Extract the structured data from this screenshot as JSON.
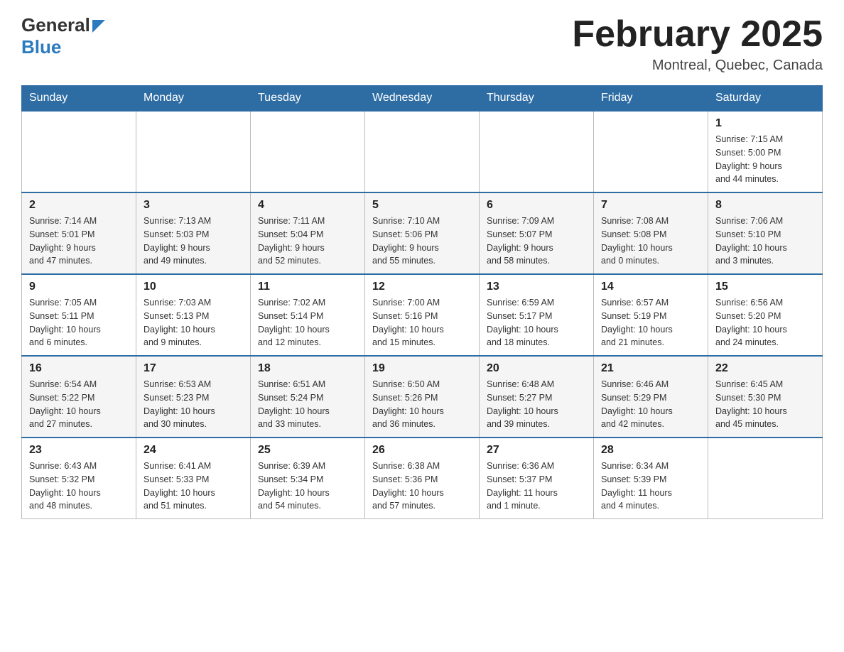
{
  "header": {
    "logo": {
      "general": "General",
      "blue": "Blue"
    },
    "title": "February 2025",
    "location": "Montreal, Quebec, Canada"
  },
  "weekdays": [
    "Sunday",
    "Monday",
    "Tuesday",
    "Wednesday",
    "Thursday",
    "Friday",
    "Saturday"
  ],
  "weeks": [
    [
      {
        "day": "",
        "info": ""
      },
      {
        "day": "",
        "info": ""
      },
      {
        "day": "",
        "info": ""
      },
      {
        "day": "",
        "info": ""
      },
      {
        "day": "",
        "info": ""
      },
      {
        "day": "",
        "info": ""
      },
      {
        "day": "1",
        "info": "Sunrise: 7:15 AM\nSunset: 5:00 PM\nDaylight: 9 hours\nand 44 minutes."
      }
    ],
    [
      {
        "day": "2",
        "info": "Sunrise: 7:14 AM\nSunset: 5:01 PM\nDaylight: 9 hours\nand 47 minutes."
      },
      {
        "day": "3",
        "info": "Sunrise: 7:13 AM\nSunset: 5:03 PM\nDaylight: 9 hours\nand 49 minutes."
      },
      {
        "day": "4",
        "info": "Sunrise: 7:11 AM\nSunset: 5:04 PM\nDaylight: 9 hours\nand 52 minutes."
      },
      {
        "day": "5",
        "info": "Sunrise: 7:10 AM\nSunset: 5:06 PM\nDaylight: 9 hours\nand 55 minutes."
      },
      {
        "day": "6",
        "info": "Sunrise: 7:09 AM\nSunset: 5:07 PM\nDaylight: 9 hours\nand 58 minutes."
      },
      {
        "day": "7",
        "info": "Sunrise: 7:08 AM\nSunset: 5:08 PM\nDaylight: 10 hours\nand 0 minutes."
      },
      {
        "day": "8",
        "info": "Sunrise: 7:06 AM\nSunset: 5:10 PM\nDaylight: 10 hours\nand 3 minutes."
      }
    ],
    [
      {
        "day": "9",
        "info": "Sunrise: 7:05 AM\nSunset: 5:11 PM\nDaylight: 10 hours\nand 6 minutes."
      },
      {
        "day": "10",
        "info": "Sunrise: 7:03 AM\nSunset: 5:13 PM\nDaylight: 10 hours\nand 9 minutes."
      },
      {
        "day": "11",
        "info": "Sunrise: 7:02 AM\nSunset: 5:14 PM\nDaylight: 10 hours\nand 12 minutes."
      },
      {
        "day": "12",
        "info": "Sunrise: 7:00 AM\nSunset: 5:16 PM\nDaylight: 10 hours\nand 15 minutes."
      },
      {
        "day": "13",
        "info": "Sunrise: 6:59 AM\nSunset: 5:17 PM\nDaylight: 10 hours\nand 18 minutes."
      },
      {
        "day": "14",
        "info": "Sunrise: 6:57 AM\nSunset: 5:19 PM\nDaylight: 10 hours\nand 21 minutes."
      },
      {
        "day": "15",
        "info": "Sunrise: 6:56 AM\nSunset: 5:20 PM\nDaylight: 10 hours\nand 24 minutes."
      }
    ],
    [
      {
        "day": "16",
        "info": "Sunrise: 6:54 AM\nSunset: 5:22 PM\nDaylight: 10 hours\nand 27 minutes."
      },
      {
        "day": "17",
        "info": "Sunrise: 6:53 AM\nSunset: 5:23 PM\nDaylight: 10 hours\nand 30 minutes."
      },
      {
        "day": "18",
        "info": "Sunrise: 6:51 AM\nSunset: 5:24 PM\nDaylight: 10 hours\nand 33 minutes."
      },
      {
        "day": "19",
        "info": "Sunrise: 6:50 AM\nSunset: 5:26 PM\nDaylight: 10 hours\nand 36 minutes."
      },
      {
        "day": "20",
        "info": "Sunrise: 6:48 AM\nSunset: 5:27 PM\nDaylight: 10 hours\nand 39 minutes."
      },
      {
        "day": "21",
        "info": "Sunrise: 6:46 AM\nSunset: 5:29 PM\nDaylight: 10 hours\nand 42 minutes."
      },
      {
        "day": "22",
        "info": "Sunrise: 6:45 AM\nSunset: 5:30 PM\nDaylight: 10 hours\nand 45 minutes."
      }
    ],
    [
      {
        "day": "23",
        "info": "Sunrise: 6:43 AM\nSunset: 5:32 PM\nDaylight: 10 hours\nand 48 minutes."
      },
      {
        "day": "24",
        "info": "Sunrise: 6:41 AM\nSunset: 5:33 PM\nDaylight: 10 hours\nand 51 minutes."
      },
      {
        "day": "25",
        "info": "Sunrise: 6:39 AM\nSunset: 5:34 PM\nDaylight: 10 hours\nand 54 minutes."
      },
      {
        "day": "26",
        "info": "Sunrise: 6:38 AM\nSunset: 5:36 PM\nDaylight: 10 hours\nand 57 minutes."
      },
      {
        "day": "27",
        "info": "Sunrise: 6:36 AM\nSunset: 5:37 PM\nDaylight: 11 hours\nand 1 minute."
      },
      {
        "day": "28",
        "info": "Sunrise: 6:34 AM\nSunset: 5:39 PM\nDaylight: 11 hours\nand 4 minutes."
      },
      {
        "day": "",
        "info": ""
      }
    ]
  ]
}
